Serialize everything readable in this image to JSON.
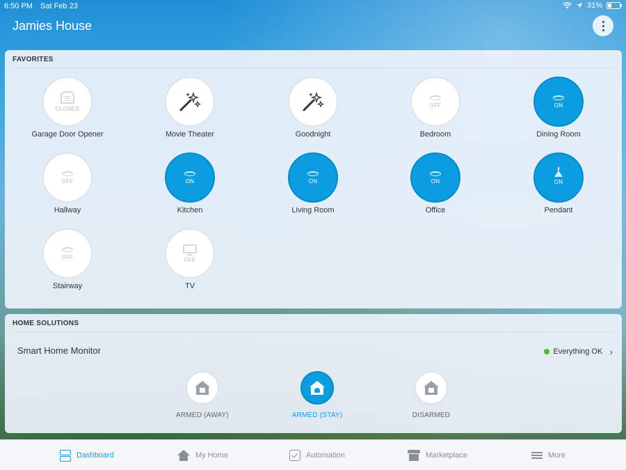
{
  "status_bar": {
    "time": "6:50 PM",
    "date": "Sat Feb 23",
    "battery": "31%"
  },
  "header": {
    "title": "Jamies House"
  },
  "favorites": {
    "title": "FAVORITES",
    "tiles": [
      {
        "label": "Garage Door Opener",
        "state": "CLOSED",
        "icon": "garage-icon",
        "on": false
      },
      {
        "label": "Movie Theater",
        "state": "",
        "icon": "magic-wand-icon",
        "on": false
      },
      {
        "label": "Goodnight",
        "state": "",
        "icon": "magic-wand-icon",
        "on": false
      },
      {
        "label": "Bedroom",
        "state": "OFF",
        "icon": "light-icon",
        "on": false
      },
      {
        "label": "Dining Room",
        "state": "ON",
        "icon": "light-icon",
        "on": true
      },
      {
        "label": "Hallway",
        "state": "OFF",
        "icon": "light-icon",
        "on": false
      },
      {
        "label": "Kitchen",
        "state": "ON",
        "icon": "light-icon",
        "on": true
      },
      {
        "label": "Living Room",
        "state": "ON",
        "icon": "light-icon",
        "on": true
      },
      {
        "label": "Office",
        "state": "ON",
        "icon": "light-icon",
        "on": true
      },
      {
        "label": "Pendant",
        "state": "ON",
        "icon": "pendant-light-icon",
        "on": true
      },
      {
        "label": "Stairway",
        "state": "OFF",
        "icon": "light-icon",
        "on": false
      },
      {
        "label": "TV",
        "state": "OFF",
        "icon": "tv-icon",
        "on": false
      }
    ]
  },
  "home_solutions": {
    "title": "HOME SOLUTIONS",
    "monitor_label": "Smart Home Monitor",
    "monitor_status": "Everything OK",
    "arm_modes": [
      {
        "label": "ARMED (AWAY)",
        "active": false
      },
      {
        "label": "ARMED (STAY)",
        "active": true
      },
      {
        "label": "DISARMED",
        "active": false
      }
    ]
  },
  "tab_bar": {
    "tabs": [
      {
        "label": "Dashboard",
        "active": true
      },
      {
        "label": "My Home",
        "active": false
      },
      {
        "label": "Automation",
        "active": false
      },
      {
        "label": "Marketplace",
        "active": false
      },
      {
        "label": "More",
        "active": false
      }
    ]
  },
  "colors": {
    "accent": "#0b9ddf",
    "ok_green": "#55b82a"
  }
}
